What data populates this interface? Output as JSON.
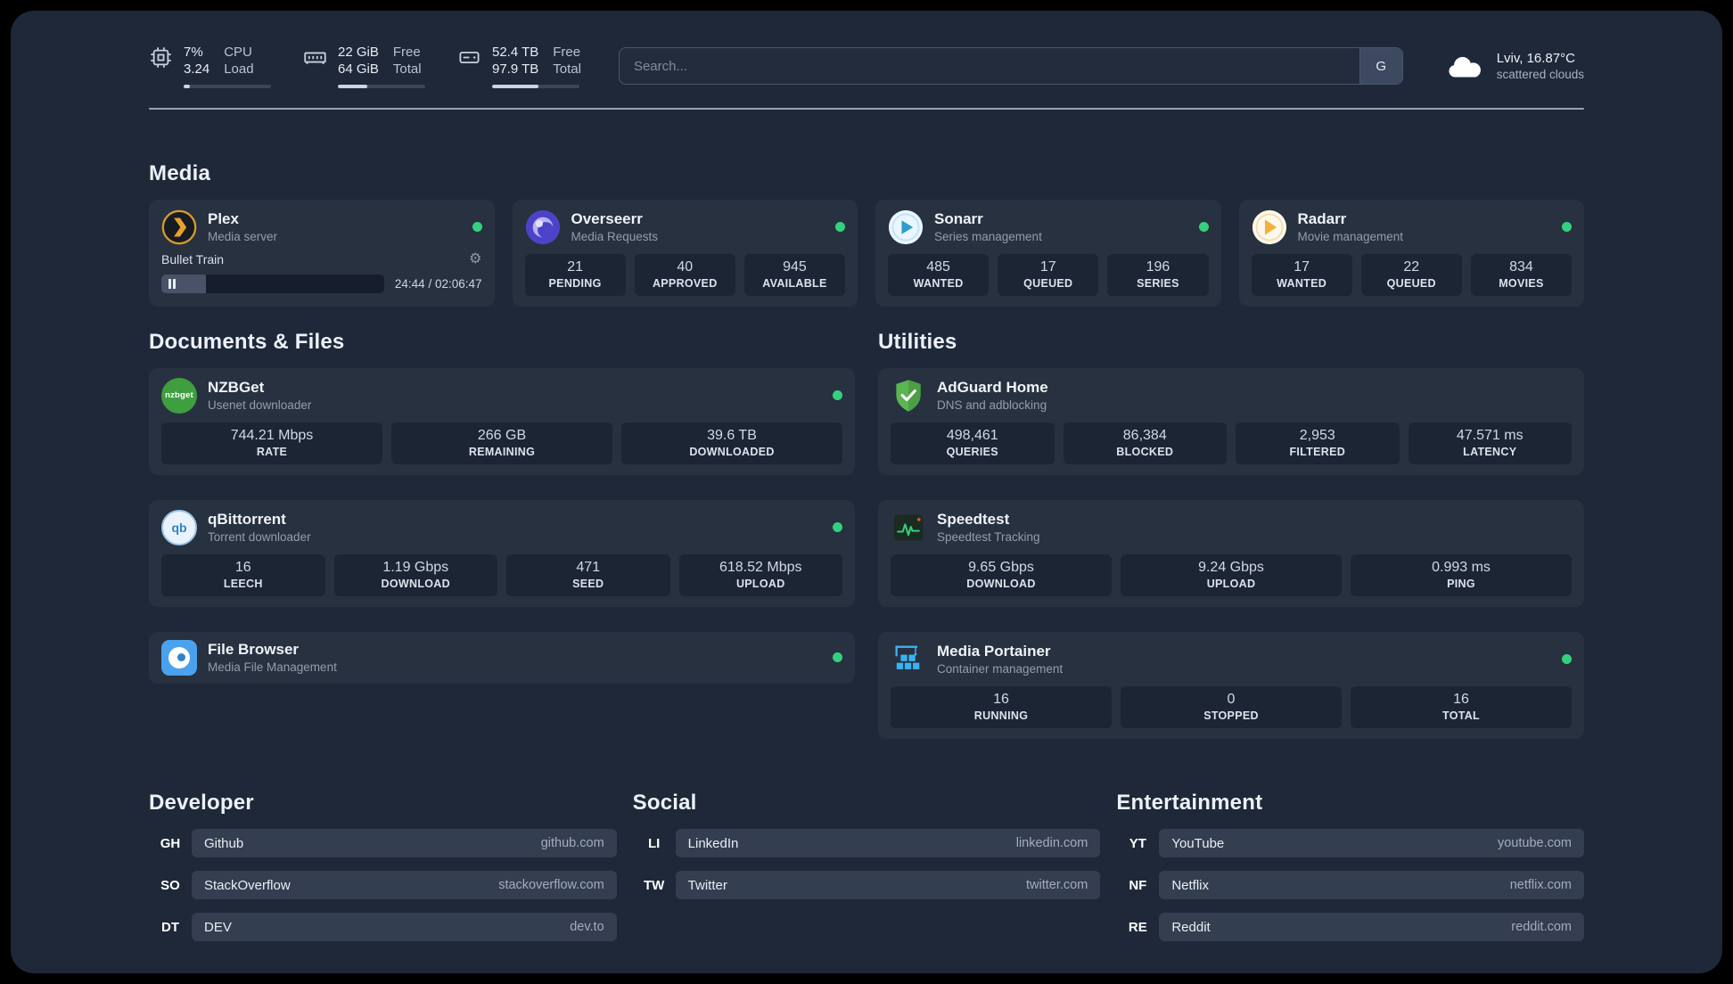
{
  "colors": {
    "page_bg": "#1e2839",
    "card_bg": "#27313f",
    "tile_bg": "#1b2534",
    "bookmark_row_bg": "#333e50",
    "status_online": "#35d07f",
    "accent_plex": "#e8a22c",
    "accent_overseerr": "#4c43c9",
    "accent_sonarr": "#33a4d8",
    "accent_radarr": "#f2b23a",
    "accent_nzbget": "#3f9e3f",
    "accent_qbittorrent": "#2f83c7",
    "accent_filebrowser": "#4aa2ee",
    "accent_adguard": "#5ab552",
    "accent_speedtest": "#35d07f",
    "accent_portainer": "#3ab2f2"
  },
  "icons": {
    "gear": "⚙"
  },
  "header": {
    "cpu": {
      "percent": "7%",
      "load": "3.24",
      "label_top": "CPU",
      "label_bottom": "Load",
      "bar_percent": 7
    },
    "memory": {
      "free": "22 GiB",
      "total": "64 GiB",
      "label_top": "Free",
      "label_bottom": "Total",
      "bar_percent": 34
    },
    "disk": {
      "free": "52.4 TB",
      "total": "97.9 TB",
      "label_top": "Free",
      "label_bottom": "Total",
      "bar_percent": 53
    },
    "search": {
      "placeholder": "Search...",
      "provider_button": "G"
    },
    "weather": {
      "location_temp": "Lviv, 16.87°C",
      "condition": "scattered clouds"
    }
  },
  "sections": {
    "media": {
      "title": "Media",
      "cards": [
        {
          "name": "Plex",
          "description": "Media server",
          "status": "online",
          "player": {
            "track": "Bullet Train",
            "time": "24:44 / 02:06:47",
            "progress_percent": 20
          }
        },
        {
          "name": "Overseerr",
          "description": "Media Requests",
          "status": "online",
          "stats": [
            {
              "value": "21",
              "label": "PENDING"
            },
            {
              "value": "40",
              "label": "APPROVED"
            },
            {
              "value": "945",
              "label": "AVAILABLE"
            }
          ]
        },
        {
          "name": "Sonarr",
          "description": "Series management",
          "status": "online",
          "stats": [
            {
              "value": "485",
              "label": "WANTED"
            },
            {
              "value": "17",
              "label": "QUEUED"
            },
            {
              "value": "196",
              "label": "SERIES"
            }
          ]
        },
        {
          "name": "Radarr",
          "description": "Movie management",
          "status": "online",
          "stats": [
            {
              "value": "17",
              "label": "WANTED"
            },
            {
              "value": "22",
              "label": "QUEUED"
            },
            {
              "value": "834",
              "label": "MOVIES"
            }
          ]
        }
      ]
    },
    "documents": {
      "title": "Documents & Files",
      "cards": [
        {
          "name": "NZBGet",
          "description": "Usenet downloader",
          "status": "online",
          "icon_text": "nzbget",
          "stats": [
            {
              "value": "744.21 Mbps",
              "label": "RATE"
            },
            {
              "value": "266 GB",
              "label": "REMAINING"
            },
            {
              "value": "39.6 TB",
              "label": "DOWNLOADED"
            }
          ]
        },
        {
          "name": "qBittorrent",
          "description": "Torrent downloader",
          "status": "online",
          "icon_text": "qb",
          "stats": [
            {
              "value": "16",
              "label": "LEECH"
            },
            {
              "value": "1.19 Gbps",
              "label": "DOWNLOAD"
            },
            {
              "value": "471",
              "label": "SEED"
            },
            {
              "value": "618.52 Mbps",
              "label": "UPLOAD"
            }
          ]
        },
        {
          "name": "File Browser",
          "description": "Media File Management",
          "status": "online",
          "stats": []
        }
      ]
    },
    "utilities": {
      "title": "Utilities",
      "cards": [
        {
          "name": "AdGuard Home",
          "description": "DNS and adblocking",
          "stats": [
            {
              "value": "498,461",
              "label": "QUERIES"
            },
            {
              "value": "86,384",
              "label": "BLOCKED"
            },
            {
              "value": "2,953",
              "label": "FILTERED"
            },
            {
              "value": "47.571 ms",
              "label": "LATENCY"
            }
          ]
        },
        {
          "name": "Speedtest",
          "description": "Speedtest Tracking",
          "stats": [
            {
              "value": "9.65 Gbps",
              "label": "DOWNLOAD"
            },
            {
              "value": "9.24 Gbps",
              "label": "UPLOAD"
            },
            {
              "value": "0.993 ms",
              "label": "PING"
            }
          ]
        },
        {
          "name": "Media Portainer",
          "description": "Container management",
          "status": "online",
          "stats": [
            {
              "value": "16",
              "label": "RUNNING"
            },
            {
              "value": "0",
              "label": "STOPPED"
            },
            {
              "value": "16",
              "label": "TOTAL"
            }
          ]
        }
      ]
    }
  },
  "bookmarks": [
    {
      "title": "Developer",
      "items": [
        {
          "abbr": "GH",
          "name": "Github",
          "url": "github.com"
        },
        {
          "abbr": "SO",
          "name": "StackOverflow",
          "url": "stackoverflow.com"
        },
        {
          "abbr": "DT",
          "name": "DEV",
          "url": "dev.to"
        }
      ]
    },
    {
      "title": "Social",
      "items": [
        {
          "abbr": "LI",
          "name": "LinkedIn",
          "url": "linkedin.com"
        },
        {
          "abbr": "TW",
          "name": "Twitter",
          "url": "twitter.com"
        }
      ]
    },
    {
      "title": "Entertainment",
      "items": [
        {
          "abbr": "YT",
          "name": "YouTube",
          "url": "youtube.com"
        },
        {
          "abbr": "NF",
          "name": "Netflix",
          "url": "netflix.com"
        },
        {
          "abbr": "RE",
          "name": "Reddit",
          "url": "reddit.com"
        }
      ]
    }
  ]
}
